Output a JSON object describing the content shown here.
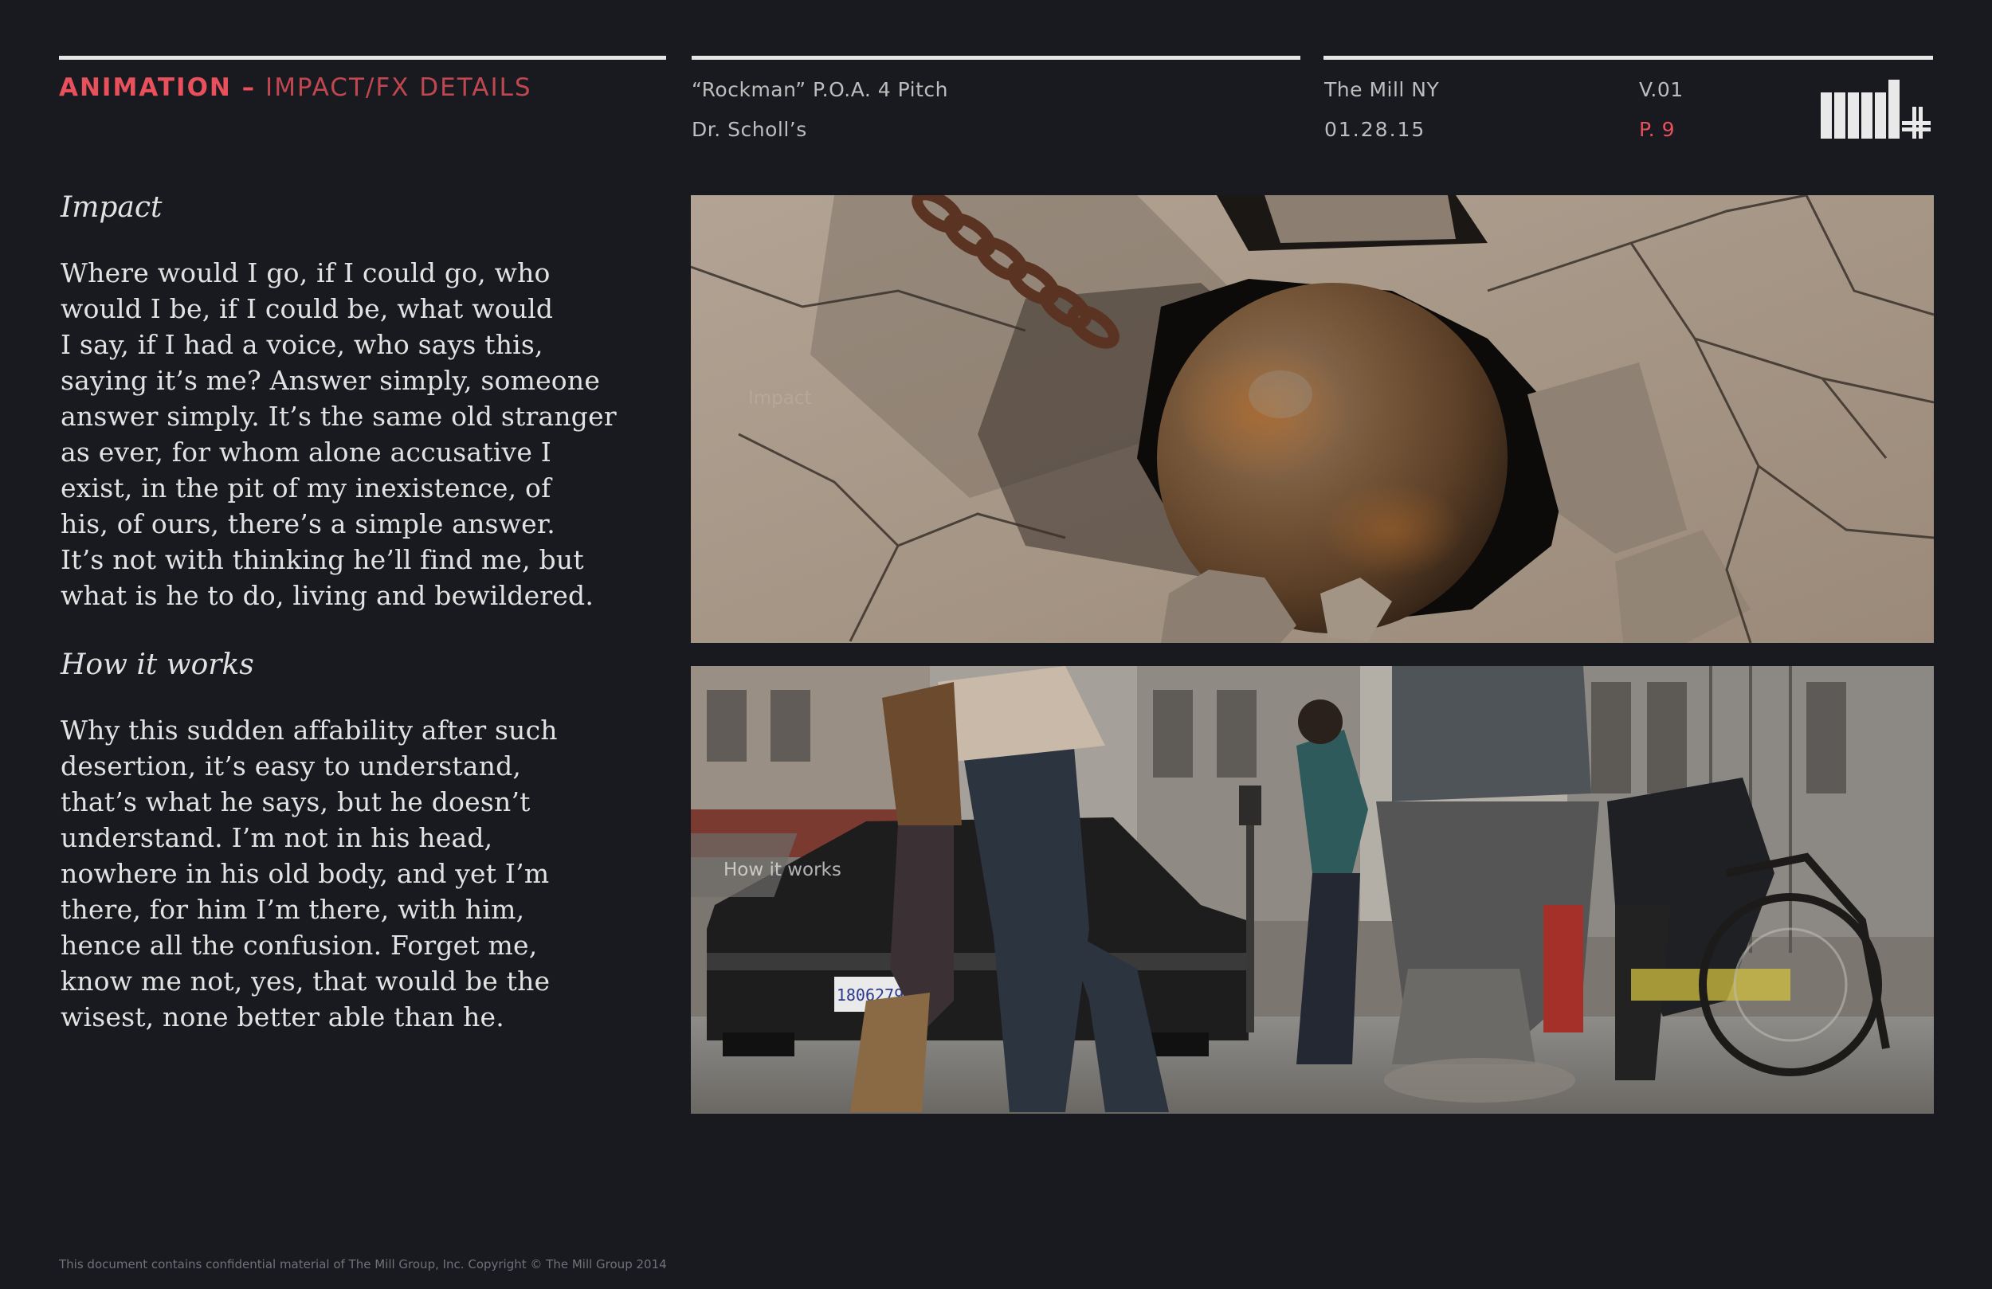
{
  "header": {
    "section_strong": "ANIMATION –",
    "section_light": "IMPACT/FX DETAILS",
    "project_title": "“Rockman” P.O.A. 4 Pitch",
    "client": "Dr. Scholl’s",
    "studio": "The Mill NY",
    "date": "01.28.15",
    "version": "V.01",
    "page": "P. 9"
  },
  "content": {
    "impact_heading": "Impact",
    "impact_text": "Where would I go, if I could go, who\nwould I be, if I could be, what would\nI say, if I had a voice, who says this,\nsaying it’s me? Answer simply, someone\nanswer simply. It’s the same old stranger\nas ever, for whom alone accusative I\nexist, in the pit of my inexistence, of\nhis, of ours, there’s a simple answer.\nIt’s not with thinking he’ll find me, but\nwhat is he to do, living and bewildered.",
    "how_heading": "How it works",
    "how_text": "Why this sudden affability after such\ndesertion, it’s easy to understand,\nthat’s what he says, but he doesn’t\nunderstand. I’m not in his head,\nnowhere in his old body, and yet I’m\nthere, for him I’m there, with him,\nhence all the confusion. Forget me,\nknow me not, yes, that would be the\nwisest, none better able than he."
  },
  "images": {
    "panel1_label": "Impact",
    "panel2_label": "How it works",
    "plate_number": "1806279"
  },
  "footer": {
    "legal": "This document contains confidential material of The Mill Group, Inc. Copyright © The Mill Group 2014"
  },
  "colors": {
    "background": "#181a1f",
    "accent": "#e8505b",
    "rule": "#e6e6e6"
  }
}
